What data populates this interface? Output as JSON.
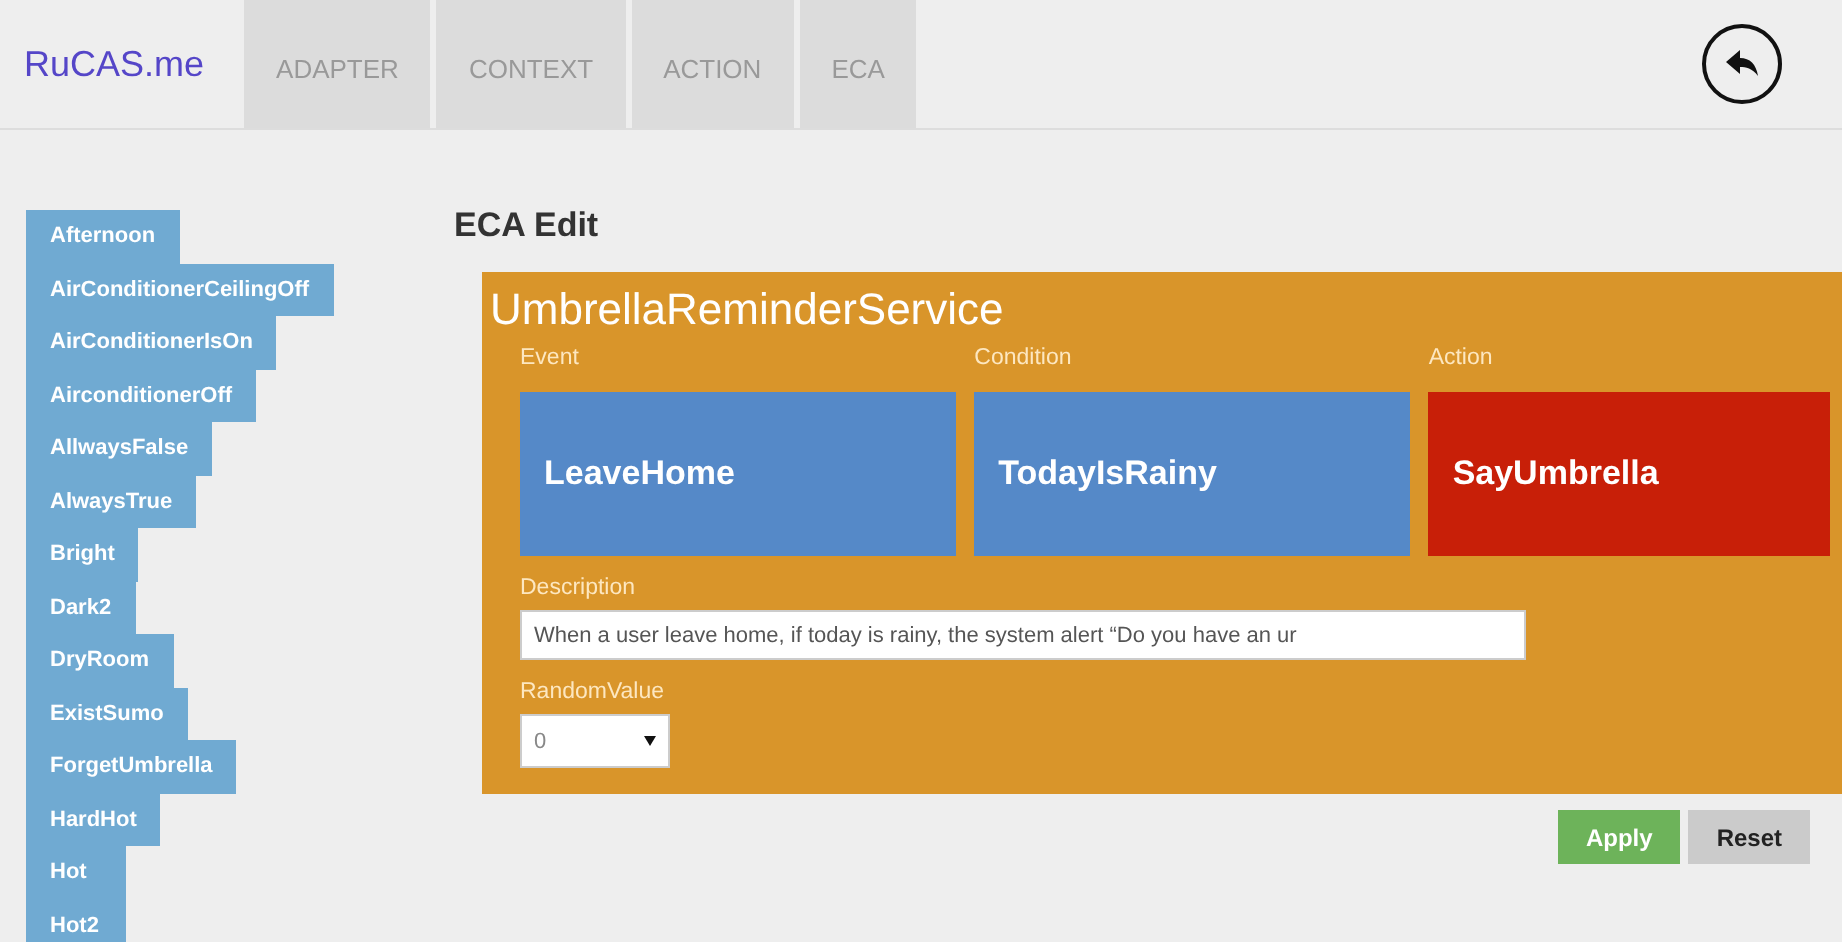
{
  "navbar": {
    "brand": "RuCAS.me",
    "tabs": [
      {
        "label": "ADAPTER",
        "selected": false
      },
      {
        "label": "CONTEXT",
        "selected": false
      },
      {
        "label": "ACTION",
        "selected": false
      },
      {
        "label": "ECA",
        "selected": false
      }
    ]
  },
  "sidebar": {
    "items": [
      "Afternoon",
      "AirConditionerCeilingOff",
      "AirConditionerIsOn",
      "AirconditionerOff",
      "AllwaysFalse",
      "AlwaysTrue",
      "Bright",
      "Dark2",
      "DryRoom",
      "ExistSumo",
      "ForgetUmbrella",
      "HardHot",
      "Hot",
      "Hot2"
    ]
  },
  "editor": {
    "heading": "ECA Edit",
    "service_name": "UmbrellaReminderService",
    "slots": [
      {
        "kind": "event",
        "label": "Event",
        "value": "LeaveHome"
      },
      {
        "kind": "condition",
        "label": "Condition",
        "value": "TodayIsRainy"
      },
      {
        "kind": "action",
        "label": "Action",
        "value": "SayUmbrella"
      }
    ],
    "description": {
      "label": "Description",
      "value": "When a user leave home, if today is rainy, the system alert “Do you have an ur"
    },
    "random_value": {
      "label": "RandomValue",
      "value": "0"
    },
    "buttons": [
      {
        "kind": "apply",
        "label": "Apply"
      },
      {
        "kind": "reset",
        "label": "Reset"
      }
    ]
  }
}
